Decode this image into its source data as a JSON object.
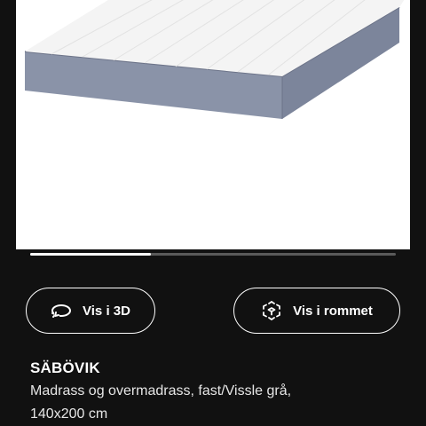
{
  "product": {
    "name": "SÄBÖVIK",
    "description_line1": "Madrass og overmadrass, fast/Vissle grå,",
    "description_line2": "140x200 cm",
    "image": {
      "subject": "mattress-product-image",
      "background_color": "#ffffff",
      "cover_color": "#f3f3f3",
      "side_color": "#8a93a8"
    }
  },
  "carousel": {
    "progress_fraction": 0.33
  },
  "actions": {
    "view_3d_label": "Vis i 3D",
    "view_3d_icon": "rotate-3d-icon",
    "view_in_room_label": "Vis i rommet",
    "view_in_room_icon": "ar-cube-icon"
  },
  "colors": {
    "background": "#111111",
    "text": "#ffffff",
    "progress_track": "#5a5a5a",
    "progress_fill": "#ffffff"
  }
}
